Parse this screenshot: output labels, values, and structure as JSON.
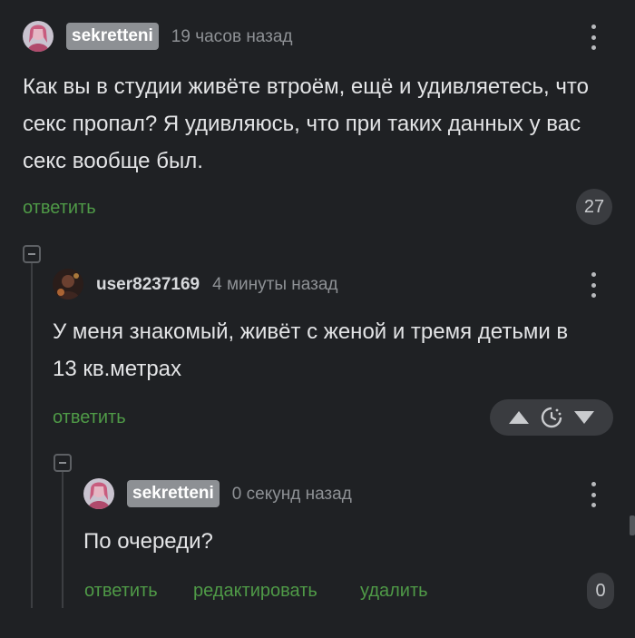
{
  "comments": [
    {
      "author": "sekretteni",
      "time": "19 часов назад",
      "text": "Как вы в студии живёте втроём, ещё и удивляетесь, что секс пропал? Я удивляюсь, что при таких данных у вас секс вообще был.",
      "reply_label": "ответить",
      "rating": "27"
    },
    {
      "author": "user8237169",
      "time": "4 минуты назад",
      "text": "У меня знакомый, живёт с женой и тремя детьми в 13 кв.метрах",
      "reply_label": "ответить"
    },
    {
      "author": "sekretteni",
      "time": "0 секунд назад",
      "text": "По очереди?",
      "reply_label": "ответить",
      "edit_label": "редактировать",
      "delete_label": "удалить",
      "rating": "0"
    }
  ],
  "icons": {
    "menu": "more-vertical-icon",
    "upvote": "arrow-up-icon",
    "timer": "timer-icon",
    "downvote": "arrow-down-icon",
    "collapse": "collapse-icon"
  },
  "colors": {
    "background": "#1f2124",
    "accent_green": "#4f9a47",
    "badge_gray": "#8d9094",
    "muted_text": "#8e9195"
  }
}
